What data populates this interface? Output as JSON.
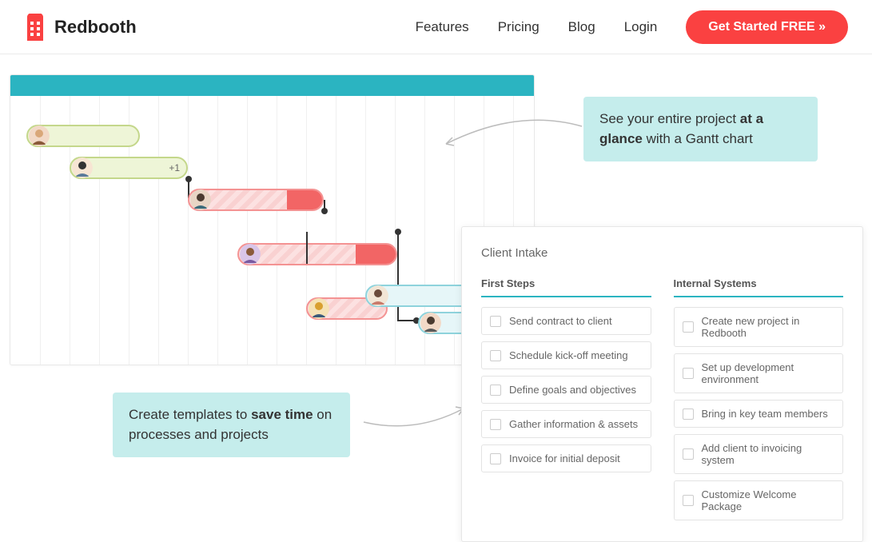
{
  "brand": {
    "name": "Redbooth"
  },
  "nav": {
    "features": "Features",
    "pricing": "Pricing",
    "blog": "Blog",
    "login": "Login",
    "cta": "Get Started FREE »"
  },
  "callout_gantt": {
    "pre": "See your entire project ",
    "bold": "at a glance",
    "post": " with a Gantt chart"
  },
  "callout_templates": {
    "pre": "Create templates to ",
    "bold": "save time",
    "post": " on processes and projects"
  },
  "template_panel": {
    "title": "Client Intake",
    "col1_head": "First Steps",
    "col2_head": "Internal Systems",
    "col1_items": [
      "Send contract to client",
      "Schedule kick-off meeting",
      "Define goals and objectives",
      "Gather information & assets",
      "Invoice for initial deposit"
    ],
    "col2_items": [
      "Create new project in Redbooth",
      "Set up development environment",
      "Bring in key team members",
      "Add client to invoicing system",
      "Customize Welcome Package"
    ]
  },
  "gantt": {
    "plus_badge": "+1"
  }
}
